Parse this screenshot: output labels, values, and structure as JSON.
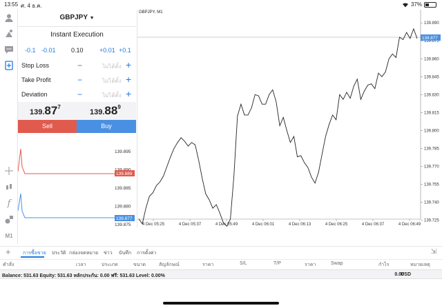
{
  "status_bar": {
    "time": "13:55",
    "date": "ศ. 4 ธ.ค.",
    "battery": "37%",
    "battery_level": 0.37
  },
  "order": {
    "symbol": "GBPJPY",
    "execution_type": "Instant Execution",
    "volume": {
      "steps_minus": [
        "-0.1",
        "-0.01"
      ],
      "value": "0.10",
      "steps_plus": [
        "+0.01",
        "+0.1"
      ]
    },
    "params": [
      {
        "label": "Stop Loss",
        "value": "ไม่ได้ตั้ง"
      },
      {
        "label": "Take Profit",
        "value": "ไม่ได้ตั้ง"
      },
      {
        "label": "Deviation",
        "value": "ไม่ได้ตั้ง"
      }
    ],
    "bid": {
      "prefix": "139.",
      "big": "87",
      "sup": "7"
    },
    "ask": {
      "prefix": "139.",
      "big": "88",
      "sup": "9"
    },
    "sell_label": "Sell",
    "buy_label": "Buy"
  },
  "tick_chart": {
    "levels": [
      "139.895",
      "139.890",
      "139.885",
      "139.880",
      "139.875"
    ],
    "ask_label": "139.889",
    "bid_label": "139.877",
    "ask_color": "#e05a4e",
    "bid_color": "#4a90e2"
  },
  "main_chart": {
    "title": "GBPJPY, M1",
    "y_labels": [
      "139.890",
      "139.875",
      "139.860",
      "139.845",
      "139.830",
      "139.815",
      "139.800",
      "139.785",
      "139.770",
      "139.755",
      "139.740",
      "139.725"
    ],
    "x_labels": [
      "4 Dec 05:25",
      "4 Dec 05:37",
      "4 Dec 05:49",
      "4 Dec 06:01",
      "4 Dec 06:13",
      "4 Dec 06:25",
      "4 Dec 06:37",
      "4 Dec 06:49"
    ],
    "current_label": "139.877",
    "current_color": "#4a90e2"
  },
  "chart_data": {
    "type": "line",
    "title": "GBPJPY, M1",
    "xlabel": "",
    "ylabel": "",
    "x": [
      "4 Dec 05:25",
      "4 Dec 05:37",
      "4 Dec 05:49",
      "4 Dec 06:01",
      "4 Dec 06:13",
      "4 Dec 06:25",
      "4 Dec 06:37",
      "4 Dec 06:49"
    ],
    "ylim": [
      139.719,
      139.893
    ],
    "series": [
      {
        "values": [
          139.726,
          139.722,
          139.735,
          139.745,
          139.748,
          139.754,
          139.757,
          139.762,
          139.77,
          139.778,
          139.785,
          139.79,
          139.794,
          139.791,
          139.787,
          139.79,
          139.788,
          139.775,
          139.76,
          139.747,
          139.742,
          139.735,
          139.738,
          139.731,
          139.723,
          139.72,
          139.726,
          139.762,
          139.812,
          139.822,
          139.813,
          139.813,
          139.819,
          139.83,
          139.829,
          139.822,
          139.822,
          139.83,
          139.834,
          139.824,
          139.804,
          139.811,
          139.8,
          139.79,
          139.795,
          139.778,
          139.779,
          139.773,
          139.769,
          139.761,
          139.756,
          139.765,
          139.78,
          139.795,
          139.805,
          139.813,
          139.809,
          139.83,
          139.826,
          139.832,
          139.827,
          139.837,
          139.843,
          139.826,
          139.833,
          139.838,
          139.839,
          139.835,
          139.848,
          139.845,
          139.849,
          139.86,
          139.864,
          139.861,
          139.878,
          139.876,
          139.882,
          139.877,
          139.885,
          139.877
        ]
      }
    ]
  },
  "bottom": {
    "tabs": [
      "การซื้อขาย",
      "ประวัติ",
      "กล่องจดหมาย",
      "ข่าว",
      "บันทึก",
      "การตั้งค่า"
    ],
    "columns": [
      "คำสั่ง",
      "เวลา",
      "ประเภท",
      "ขนาด",
      "สัญลักษณ์",
      "ราคา",
      "S/L",
      "T/P",
      "ราคา",
      "Swap",
      "กำไร",
      "หมายเหตุ"
    ],
    "balance_text": "Balance: 531.63 Equity: 531.63 หลักประกัน: 0.00 ฟรี: 531.63 Level: 0.00%",
    "total": "0.00",
    "currency": "USD"
  }
}
